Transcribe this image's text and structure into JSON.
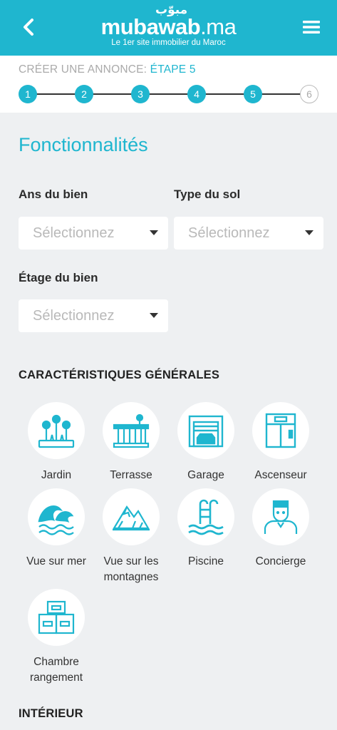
{
  "header": {
    "logo_arabic": "مبوّب",
    "logo_main": "mubawab",
    "logo_tld": ".ma",
    "tagline": "Le 1er site immobilier du Maroc"
  },
  "steps": {
    "caption_prefix": "CRÉER UNE ANNONCE: ",
    "caption_current": "ÉTAPE 5",
    "items": [
      "1",
      "2",
      "3",
      "4",
      "5",
      "6"
    ],
    "current": 5
  },
  "form": {
    "title": "Fonctionnalités",
    "ans_label": "Ans du bien",
    "ans_placeholder": "Sélectionnez",
    "sol_label": "Type du sol",
    "sol_placeholder": "Sélectionnez",
    "etage_label": "Étage du bien",
    "etage_placeholder": "Sélectionnez"
  },
  "general": {
    "title": "CARACTÉRISTIQUES GÉNÉRALES",
    "features": [
      {
        "label": "Jardin",
        "icon": "garden-icon"
      },
      {
        "label": "Terrasse",
        "icon": "terrace-icon"
      },
      {
        "label": "Garage",
        "icon": "garage-icon"
      },
      {
        "label": "Ascenseur",
        "icon": "elevator-icon"
      },
      {
        "label": "Vue sur mer",
        "icon": "sea-view-icon"
      },
      {
        "label": "Vue sur les montagnes",
        "icon": "mountain-view-icon"
      },
      {
        "label": "Piscine",
        "icon": "pool-icon"
      },
      {
        "label": "Concierge",
        "icon": "concierge-icon"
      },
      {
        "label": "Chambre rangement",
        "icon": "storage-room-icon"
      }
    ]
  },
  "interior": {
    "title": "INTÉRIEUR"
  },
  "colors": {
    "brand": "#1fb6cf",
    "background": "#eef0f2"
  }
}
